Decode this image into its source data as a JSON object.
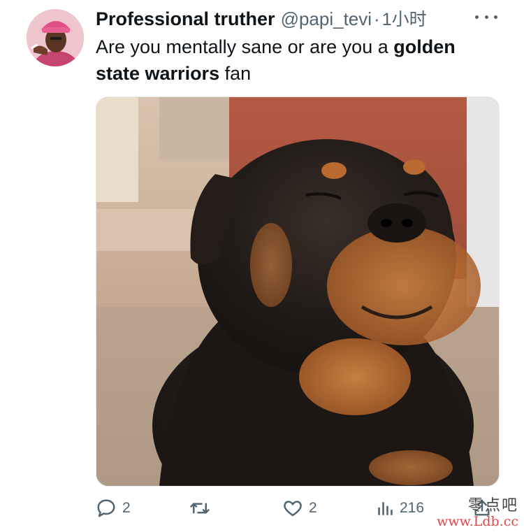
{
  "tweet": {
    "display_name": "Professional truther",
    "handle": "@papi_tevi",
    "separator": "·",
    "time": "1小时",
    "text_parts": [
      {
        "text": "Are  you mentally sane or are you a ",
        "bold": false
      },
      {
        "text": "golden state warriors",
        "bold": true
      },
      {
        "text": " fan",
        "bold": false
      }
    ],
    "more_icon": "more-dots-icon",
    "avatar": "avatar-image",
    "media": "rottweiler-photo"
  },
  "actions": {
    "reply": {
      "icon": "reply-icon",
      "count": "2"
    },
    "retweet": {
      "icon": "retweet-icon",
      "count": ""
    },
    "like": {
      "icon": "heart-icon",
      "count": "2"
    },
    "views": {
      "icon": "views-chart-icon",
      "count": "216"
    },
    "share": {
      "icon": "share-icon"
    }
  },
  "watermark": {
    "top": "零点吧",
    "bottom": "www.Ldb.cc"
  },
  "colors": {
    "text": "#0f1419",
    "secondary": "#536471",
    "watermark_red": "#e04646"
  }
}
